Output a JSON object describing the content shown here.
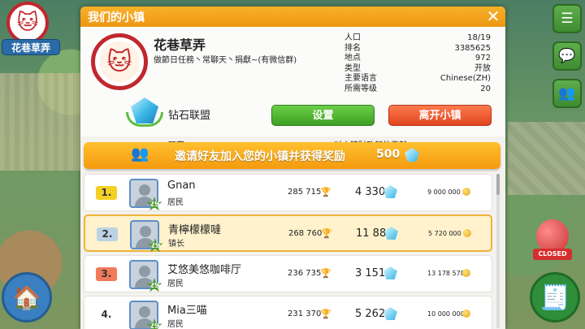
{
  "hud": {
    "town_badge_name": "花巷草弄"
  },
  "dialog": {
    "title": "我们的小镇",
    "close_label": "✕",
    "town": {
      "name": "花巷草弄",
      "description": "做節日任務丶常聊天丶捐獻~(有微信群)"
    },
    "stats": [
      {
        "key": "人口",
        "value": "18/19"
      },
      {
        "key": "排名",
        "value": "3385625"
      },
      {
        "key": "地点",
        "value": "972"
      },
      {
        "key": "类型",
        "value": "开放"
      },
      {
        "key": "主要语言",
        "value": "Chinese(ZH)"
      },
      {
        "key": "所需等级",
        "value": "20"
      }
    ],
    "alliance": "钻石联盟",
    "buttons": {
      "settings": "设置",
      "leave": "离开小镇"
    },
    "columns": {
      "player": "玩家",
      "contribution": "对小镇财政部的贡献："
    },
    "invite": {
      "text": "邀请好友加入您的小镇并获得奖励",
      "reward": "500"
    },
    "players": [
      {
        "rank": "1.",
        "name": "Gnan",
        "role": "居民",
        "level": "29",
        "trophies": "285 715",
        "gems": "4 330",
        "coins": "9 000 000"
      },
      {
        "rank": "2.",
        "name": "青檸檬檬噠",
        "role": "镇长",
        "level": "29",
        "trophies": "268 760",
        "gems": "11 880",
        "coins": "5 720 000"
      },
      {
        "rank": "3.",
        "name": "艾悠美悠咖啡厅",
        "role": "居民",
        "level": "29",
        "trophies": "236 735",
        "gems": "3 151",
        "coins": "13 178 578"
      },
      {
        "rank": "4.",
        "name": "Mia三喵",
        "role": "居民",
        "level": "29",
        "trophies": "231 370",
        "gems": "5 262",
        "coins": "10 000 000"
      }
    ]
  },
  "map_overlay": {
    "closed_tag": "CLOSED"
  },
  "colors": {
    "header": "#f5a31d",
    "settings_button": "#4fb830",
    "leave_button": "#ef5a2f",
    "rank_gold": "#f3d024",
    "rank_silver": "#bcd3e4",
    "rank_bronze": "#f07a5a"
  }
}
